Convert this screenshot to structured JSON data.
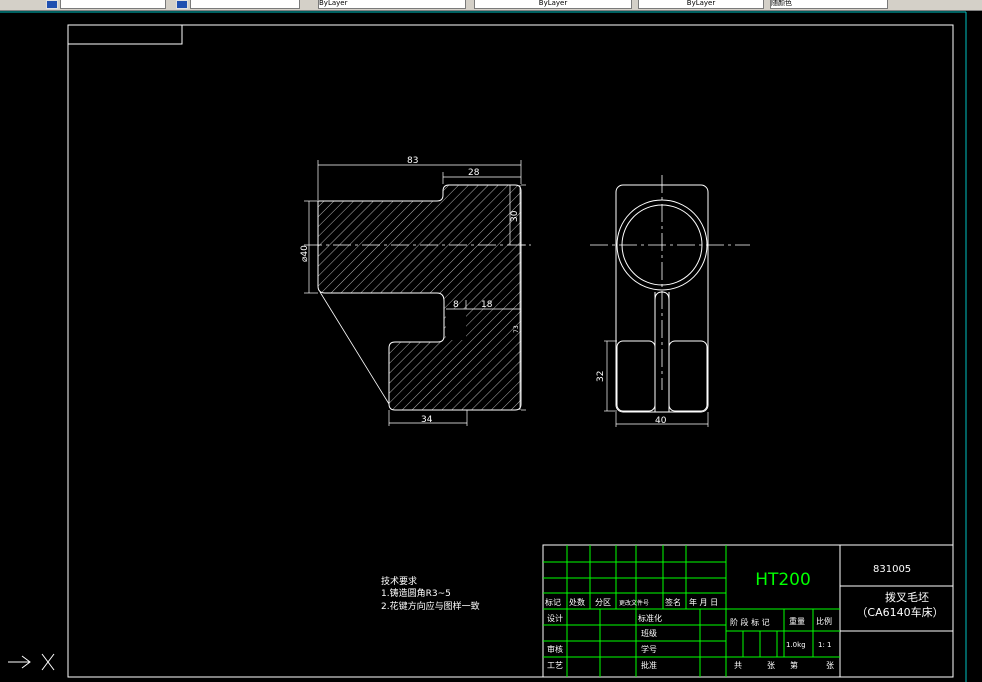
{
  "toolbar": {
    "layer_combo": "ByLayer",
    "linetype_combo": "ByLayer",
    "lineweight_combo": "ByLayer",
    "plotstyle_combo": "随颜色",
    "icons": [
      "layer-manager-icon",
      "layer-state-icon"
    ]
  },
  "drawing": {
    "front_view": {
      "dim_width_total": "83",
      "dim_top_width": "28",
      "dim_dia": "⌀40",
      "dim_right_height": "30",
      "dim_slot": "8",
      "dim_neck": "18",
      "dim_total_height": "73",
      "dim_bottom_width": "34"
    },
    "side_view": {
      "dim_pad_height": "32",
      "dim_width": "40"
    },
    "tech_requirements": {
      "title": "技术要求",
      "line1": "1.铸造圆角R3~5",
      "line2": "2.花键方向应与图样一致"
    }
  },
  "title_block": {
    "material": "HT200",
    "drawing_number": "831005",
    "part_name": "拨叉毛坯",
    "machine": "（CA6140车床）",
    "headers": {
      "mark": "标记",
      "count": "处数",
      "zone": "分区",
      "change_doc": "更改文件号",
      "signature": "签名",
      "date": "年 月 日"
    },
    "rows": {
      "design": "设计",
      "standardize": "标准化",
      "class": "班级",
      "review": "审核",
      "student_id": "学号",
      "process": "工艺",
      "approve": "批准"
    },
    "stage_mark": "阶 段 标 记",
    "weight_label": "重量",
    "scale_label": "比例",
    "weight_value": "1.0kg",
    "scale_value": "1: 1",
    "sheets": {
      "total": "共",
      "sheet1": "张",
      "current": "第",
      "sheet2": "张"
    }
  },
  "colors": {
    "background": "#000000",
    "frame": "#ffffff",
    "dimension": "#ffffff",
    "title_grid": "#00ff00",
    "title_text": "#ffffff",
    "material_text": "#00ff00",
    "viewport_border": "#00c0c0"
  }
}
